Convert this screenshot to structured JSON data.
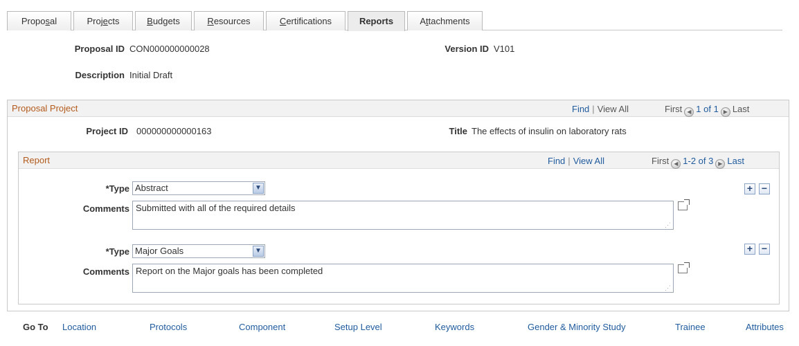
{
  "tabs": [
    {
      "pre": "Propo",
      "u": "s",
      "post": "al"
    },
    {
      "pre": "Proj",
      "u": "e",
      "post": "cts"
    },
    {
      "pre": "",
      "u": "B",
      "post": "udgets"
    },
    {
      "pre": "",
      "u": "R",
      "post": "esources"
    },
    {
      "pre": "",
      "u": "C",
      "post": "ertifications"
    },
    {
      "pre": "Reports",
      "u": "",
      "post": ""
    },
    {
      "pre": "A",
      "u": "t",
      "post": "tachments"
    }
  ],
  "header": {
    "proposal_id_label": "Proposal ID",
    "proposal_id": "CON000000000028",
    "version_id_label": "Version ID",
    "version_id": "V101",
    "description_label": "Description",
    "description": "Initial Draft"
  },
  "proposal_project": {
    "title": "Proposal Project",
    "find": "Find",
    "view_all": "View All",
    "first": "First",
    "count": "1 of 1",
    "last": "Last",
    "project_id_label": "Project ID",
    "project_id": "000000000000163",
    "title_label": "Title",
    "title_value": "The effects of insulin on laboratory rats"
  },
  "report": {
    "title": "Report",
    "find": "Find",
    "view_all": "View All",
    "first": "First",
    "count": "1-2 of 3",
    "last": "Last",
    "type_label": "*Type",
    "comments_label": "Comments",
    "rows": [
      {
        "type": "Abstract",
        "comments": "Submitted with all of the required details"
      },
      {
        "type": "Major Goals",
        "comments": "Report on the  Major goals has been completed"
      }
    ]
  },
  "goto": {
    "label": "Go To",
    "links": [
      "Location",
      "Protocols",
      "Component",
      "Setup Level",
      "Keywords",
      "Gender & Minority Study",
      "Trainee",
      "Attributes"
    ]
  },
  "icons": {
    "plus": "+",
    "minus": "−",
    "dropdown": "▾",
    "prev": "◀",
    "next": "▶"
  }
}
